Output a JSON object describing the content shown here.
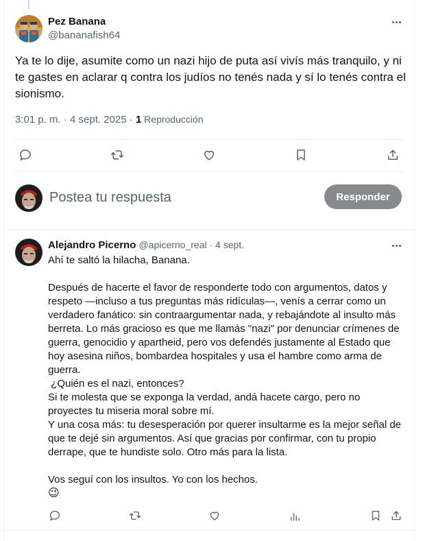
{
  "main_post": {
    "author_name": "Pez Banana",
    "author_handle": "@bananafish64",
    "text": "Ya te lo dije, asumite como un nazi hijo de puta así vivís más tranquilo, y ni te gastes en aclarar q contra los judíos no tenés nada y sí lo tenés contra el sionismo.",
    "time": "3:01 p. m. · 4 sept. 2025 · ",
    "views_count": "1",
    "views_label": " Reproducción",
    "actions": [
      "reply-icon",
      "retweet-icon",
      "like-icon",
      "bookmark-icon",
      "share-icon"
    ]
  },
  "composer": {
    "placeholder": "Postea tu respuesta",
    "button_label": "Responder"
  },
  "reply": {
    "author_name": "Alejandro Picerno",
    "author_handle": "@apicerno_real",
    "date": " · 4 sept.",
    "text": "Ahí te saltó la hilacha, Banana.\n\nDespués de hacerte el favor de responderte todo con argumentos, datos y respeto —incluso a tus preguntas más ridículas—, venís a cerrar como un verdadero fanático: sin contraargumentar nada, y rebajándote al insulto más berreta. Lo más gracioso es que me llamás \"nazi\" por denunciar crímenes de guerra, genocidio y apartheid, pero vos defendés justamente al Estado que hoy asesina niños, bombardea hospitales y usa el hambre como arma de guerra.\n ¿Quién es el nazi, entonces?\nSi te molesta que se exponga la verdad, andá hacete cargo, pero no proyectes tu miseria moral sobre mí.\nY una cosa más: tu desesperación por querer insultarme es la mejor señal de que te dejé sin argumentos. Así que gracias por confirmar, con tu propio derrape, que te hundiste solo. Otro más para la lista.\n\nVos seguí con los insultos. Yo con los hechos.",
    "emoji": "😉",
    "actions": [
      "reply-icon",
      "retweet-icon",
      "like-icon",
      "analytics-icon",
      "bookmark-icon",
      "share-icon"
    ]
  },
  "colors": {
    "text": "#0f1419",
    "muted": "#536471",
    "border": "#eff3f4",
    "button_disabled": "#87898c"
  }
}
